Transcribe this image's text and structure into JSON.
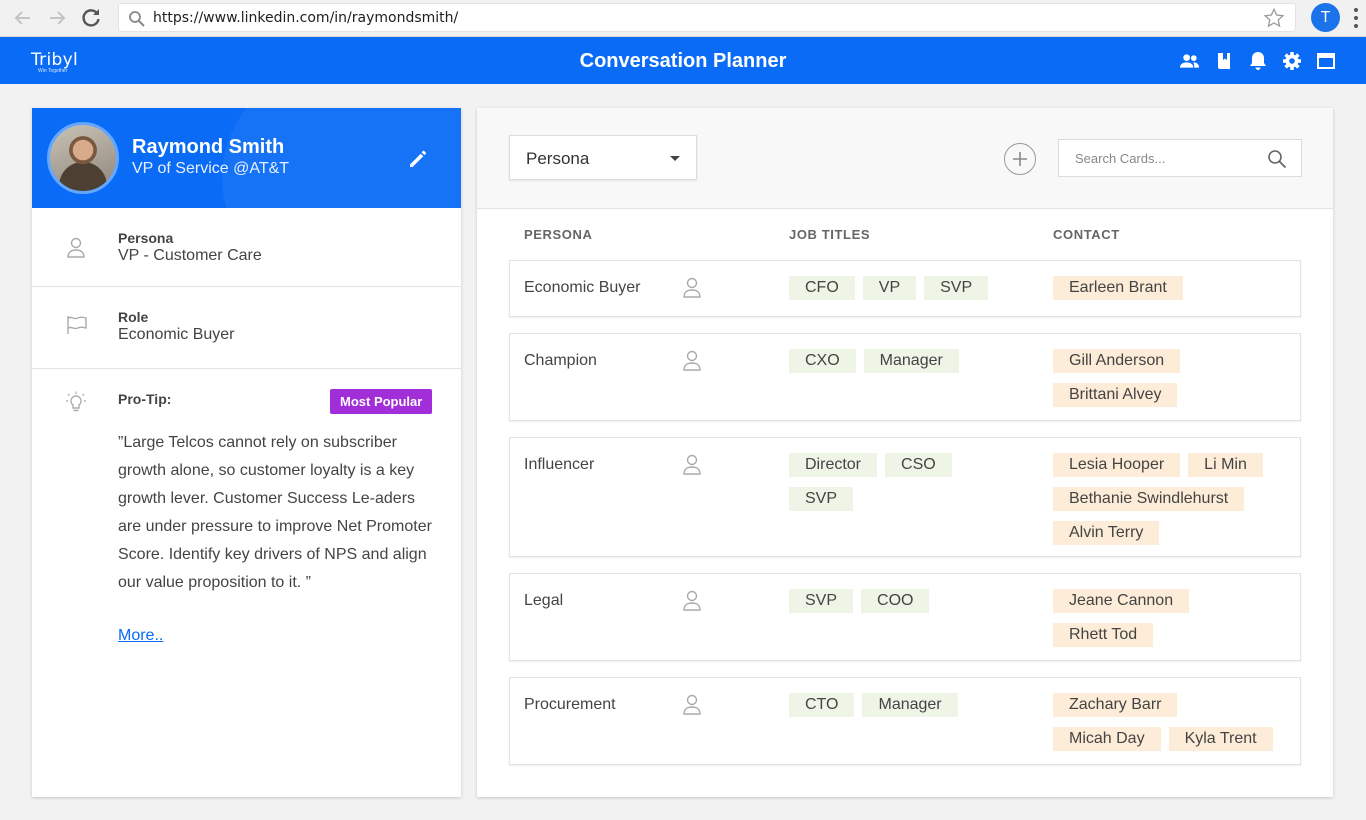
{
  "browser": {
    "url": "https://www.linkedin.com/in/raymondsmith/",
    "profile_initial": "T"
  },
  "header": {
    "brand": "Tribyl",
    "brand_tagline": "Win Together",
    "title": "Conversation Planner",
    "icons": [
      "people-icon",
      "book-icon",
      "bell-icon",
      "gear-icon",
      "window-icon"
    ]
  },
  "profile": {
    "name": "Raymond Smith",
    "title": "VP of Service @AT&T",
    "persona_label": "Persona",
    "persona_value": "VP - Customer Care",
    "role_label": "Role",
    "role_value": "Economic Buyer",
    "tip_label": "Pro-Tip:",
    "tip_badge": "Most Popular",
    "tip_text": "”Large Telcos cannot rely on subscriber growth alone, so customer loyalty is a key growth lever. Customer Success Le-aders are under pressure to improve Net Promoter Score. Identify key drivers of NPS and align our value proposition to it. ”",
    "more_link": "More..",
    "accent": "#0a6cf6",
    "badge_color": "#a12ed8"
  },
  "planner": {
    "filter_value": "Persona",
    "search_placeholder": "Search Cards...",
    "columns": {
      "persona": "PERSONA",
      "job_titles": "JOB TITLES",
      "contact": "CONTACT"
    },
    "rows": [
      {
        "persona": "Economic Buyer",
        "jobs": [
          "CFO",
          "VP",
          "SVP"
        ],
        "contacts": [
          "Earleen Brant"
        ]
      },
      {
        "persona": "Champion",
        "jobs": [
          "CXO",
          "Manager"
        ],
        "contacts": [
          "Gill Anderson",
          "Brittani Alvey"
        ]
      },
      {
        "persona": "Influencer",
        "jobs": [
          "Director",
          "CSO",
          "SVP"
        ],
        "contacts": [
          "Lesia Hooper",
          "Li Min",
          "Bethanie Swindlehurst",
          "Alvin Terry"
        ]
      },
      {
        "persona": "Legal",
        "jobs": [
          "SVP",
          "COO"
        ],
        "contacts": [
          "Jeane Cannon",
          "Rhett Tod"
        ]
      },
      {
        "persona": "Procurement",
        "jobs": [
          "CTO",
          "Manager"
        ],
        "contacts": [
          "Zachary Barr",
          "Micah Day",
          "Kyla Trent"
        ]
      }
    ],
    "job_tag_color": "#eef4e6",
    "contact_tag_color": "#fdecd7"
  }
}
